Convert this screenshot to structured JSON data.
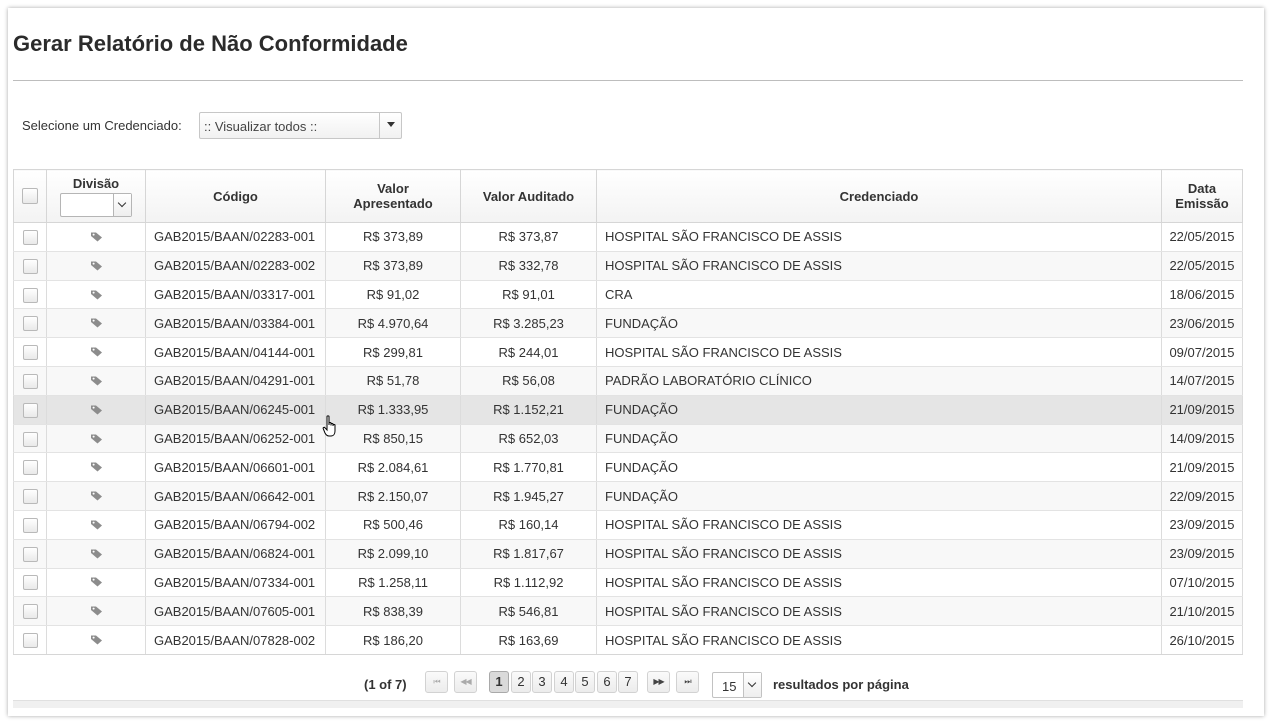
{
  "page": {
    "title": "Gerar Relatório de Não Conformidade"
  },
  "filter": {
    "label": "Selecione um Credenciado:",
    "value": ":: Visualizar todos ::"
  },
  "table": {
    "headers": {
      "divisao": "Divisão",
      "codigo": "Código",
      "valor_apresentado_line1": "Valor",
      "valor_apresentado_line2": "Apresentado",
      "valor_auditado": "Valor Auditado",
      "credenciado": "Credenciado",
      "data_emissao_line1": "Data",
      "data_emissao_line2": "Emissão"
    },
    "row_icon": "tag-icon",
    "rows": [
      {
        "codigo": "GAB2015/BAAN/02283-001",
        "valor_apresentado": "R$ 373,89",
        "valor_auditado": "R$ 373,87",
        "credenciado": "HOSPITAL SÃO FRANCISCO DE ASSIS",
        "data": "22/05/2015"
      },
      {
        "codigo": "GAB2015/BAAN/02283-002",
        "valor_apresentado": "R$ 373,89",
        "valor_auditado": "R$ 332,78",
        "credenciado": "HOSPITAL SÃO FRANCISCO DE ASSIS",
        "data": "22/05/2015"
      },
      {
        "codigo": "GAB2015/BAAN/03317-001",
        "valor_apresentado": "R$ 91,02",
        "valor_auditado": "R$ 91,01",
        "credenciado": "CRA",
        "data": "18/06/2015"
      },
      {
        "codigo": "GAB2015/BAAN/03384-001",
        "valor_apresentado": "R$ 4.970,64",
        "valor_auditado": "R$ 3.285,23",
        "credenciado": "FUNDAÇÃO",
        "data": "23/06/2015"
      },
      {
        "codigo": "GAB2015/BAAN/04144-001",
        "valor_apresentado": "R$ 299,81",
        "valor_auditado": "R$ 244,01",
        "credenciado": "HOSPITAL SÃO FRANCISCO DE ASSIS",
        "data": "09/07/2015"
      },
      {
        "codigo": "GAB2015/BAAN/04291-001",
        "valor_apresentado": "R$ 51,78",
        "valor_auditado": "R$ 56,08",
        "credenciado": "PADRÃO LABORATÓRIO CLÍNICO",
        "data": "14/07/2015"
      },
      {
        "codigo": "GAB2015/BAAN/06245-001",
        "valor_apresentado": "R$ 1.333,95",
        "valor_auditado": "R$ 1.152,21",
        "credenciado": "FUNDAÇÃO",
        "data": "21/09/2015"
      },
      {
        "codigo": "GAB2015/BAAN/06252-001",
        "valor_apresentado": "R$ 850,15",
        "valor_auditado": "R$ 652,03",
        "credenciado": "FUNDAÇÃO",
        "data": "14/09/2015"
      },
      {
        "codigo": "GAB2015/BAAN/06601-001",
        "valor_apresentado": "R$ 2.084,61",
        "valor_auditado": "R$ 1.770,81",
        "credenciado": "FUNDAÇÃO",
        "data": "21/09/2015"
      },
      {
        "codigo": "GAB2015/BAAN/06642-001",
        "valor_apresentado": "R$ 2.150,07",
        "valor_auditado": "R$ 1.945,27",
        "credenciado": "FUNDAÇÃO",
        "data": "22/09/2015"
      },
      {
        "codigo": "GAB2015/BAAN/06794-002",
        "valor_apresentado": "R$ 500,46",
        "valor_auditado": "R$ 160,14",
        "credenciado": "HOSPITAL SÃO FRANCISCO DE ASSIS",
        "data": "23/09/2015"
      },
      {
        "codigo": "GAB2015/BAAN/06824-001",
        "valor_apresentado": "R$ 2.099,10",
        "valor_auditado": "R$ 1.817,67",
        "credenciado": "HOSPITAL SÃO FRANCISCO DE ASSIS",
        "data": "23/09/2015"
      },
      {
        "codigo": "GAB2015/BAAN/07334-001",
        "valor_apresentado": "R$ 1.258,11",
        "valor_auditado": "R$ 1.112,92",
        "credenciado": "HOSPITAL SÃO FRANCISCO DE ASSIS",
        "data": "07/10/2015"
      },
      {
        "codigo": "GAB2015/BAAN/07605-001",
        "valor_apresentado": "R$ 838,39",
        "valor_auditado": "R$ 546,81",
        "credenciado": "HOSPITAL SÃO FRANCISCO DE ASSIS",
        "data": "21/10/2015"
      },
      {
        "codigo": "GAB2015/BAAN/07828-002",
        "valor_apresentado": "R$ 186,20",
        "valor_auditado": "R$ 163,69",
        "credenciado": "HOSPITAL SÃO FRANCISCO DE ASSIS",
        "data": "26/10/2015"
      }
    ]
  },
  "pagination": {
    "info": "(1 of 7)",
    "pages": [
      "1",
      "2",
      "3",
      "4",
      "5",
      "6",
      "7"
    ],
    "current_page": "1",
    "first_icon": "⏮",
    "prev_icon": "◀◀",
    "next_icon": "▶▶",
    "last_icon": "⏭",
    "rows_per_page": "15",
    "rows_per_page_label": "resultados por página"
  },
  "colors": {
    "header_bg": "#f3f3f3",
    "row_alt": "#f8f8f8",
    "row_hover": "#e5e5e5",
    "active_page": "#dadada"
  }
}
